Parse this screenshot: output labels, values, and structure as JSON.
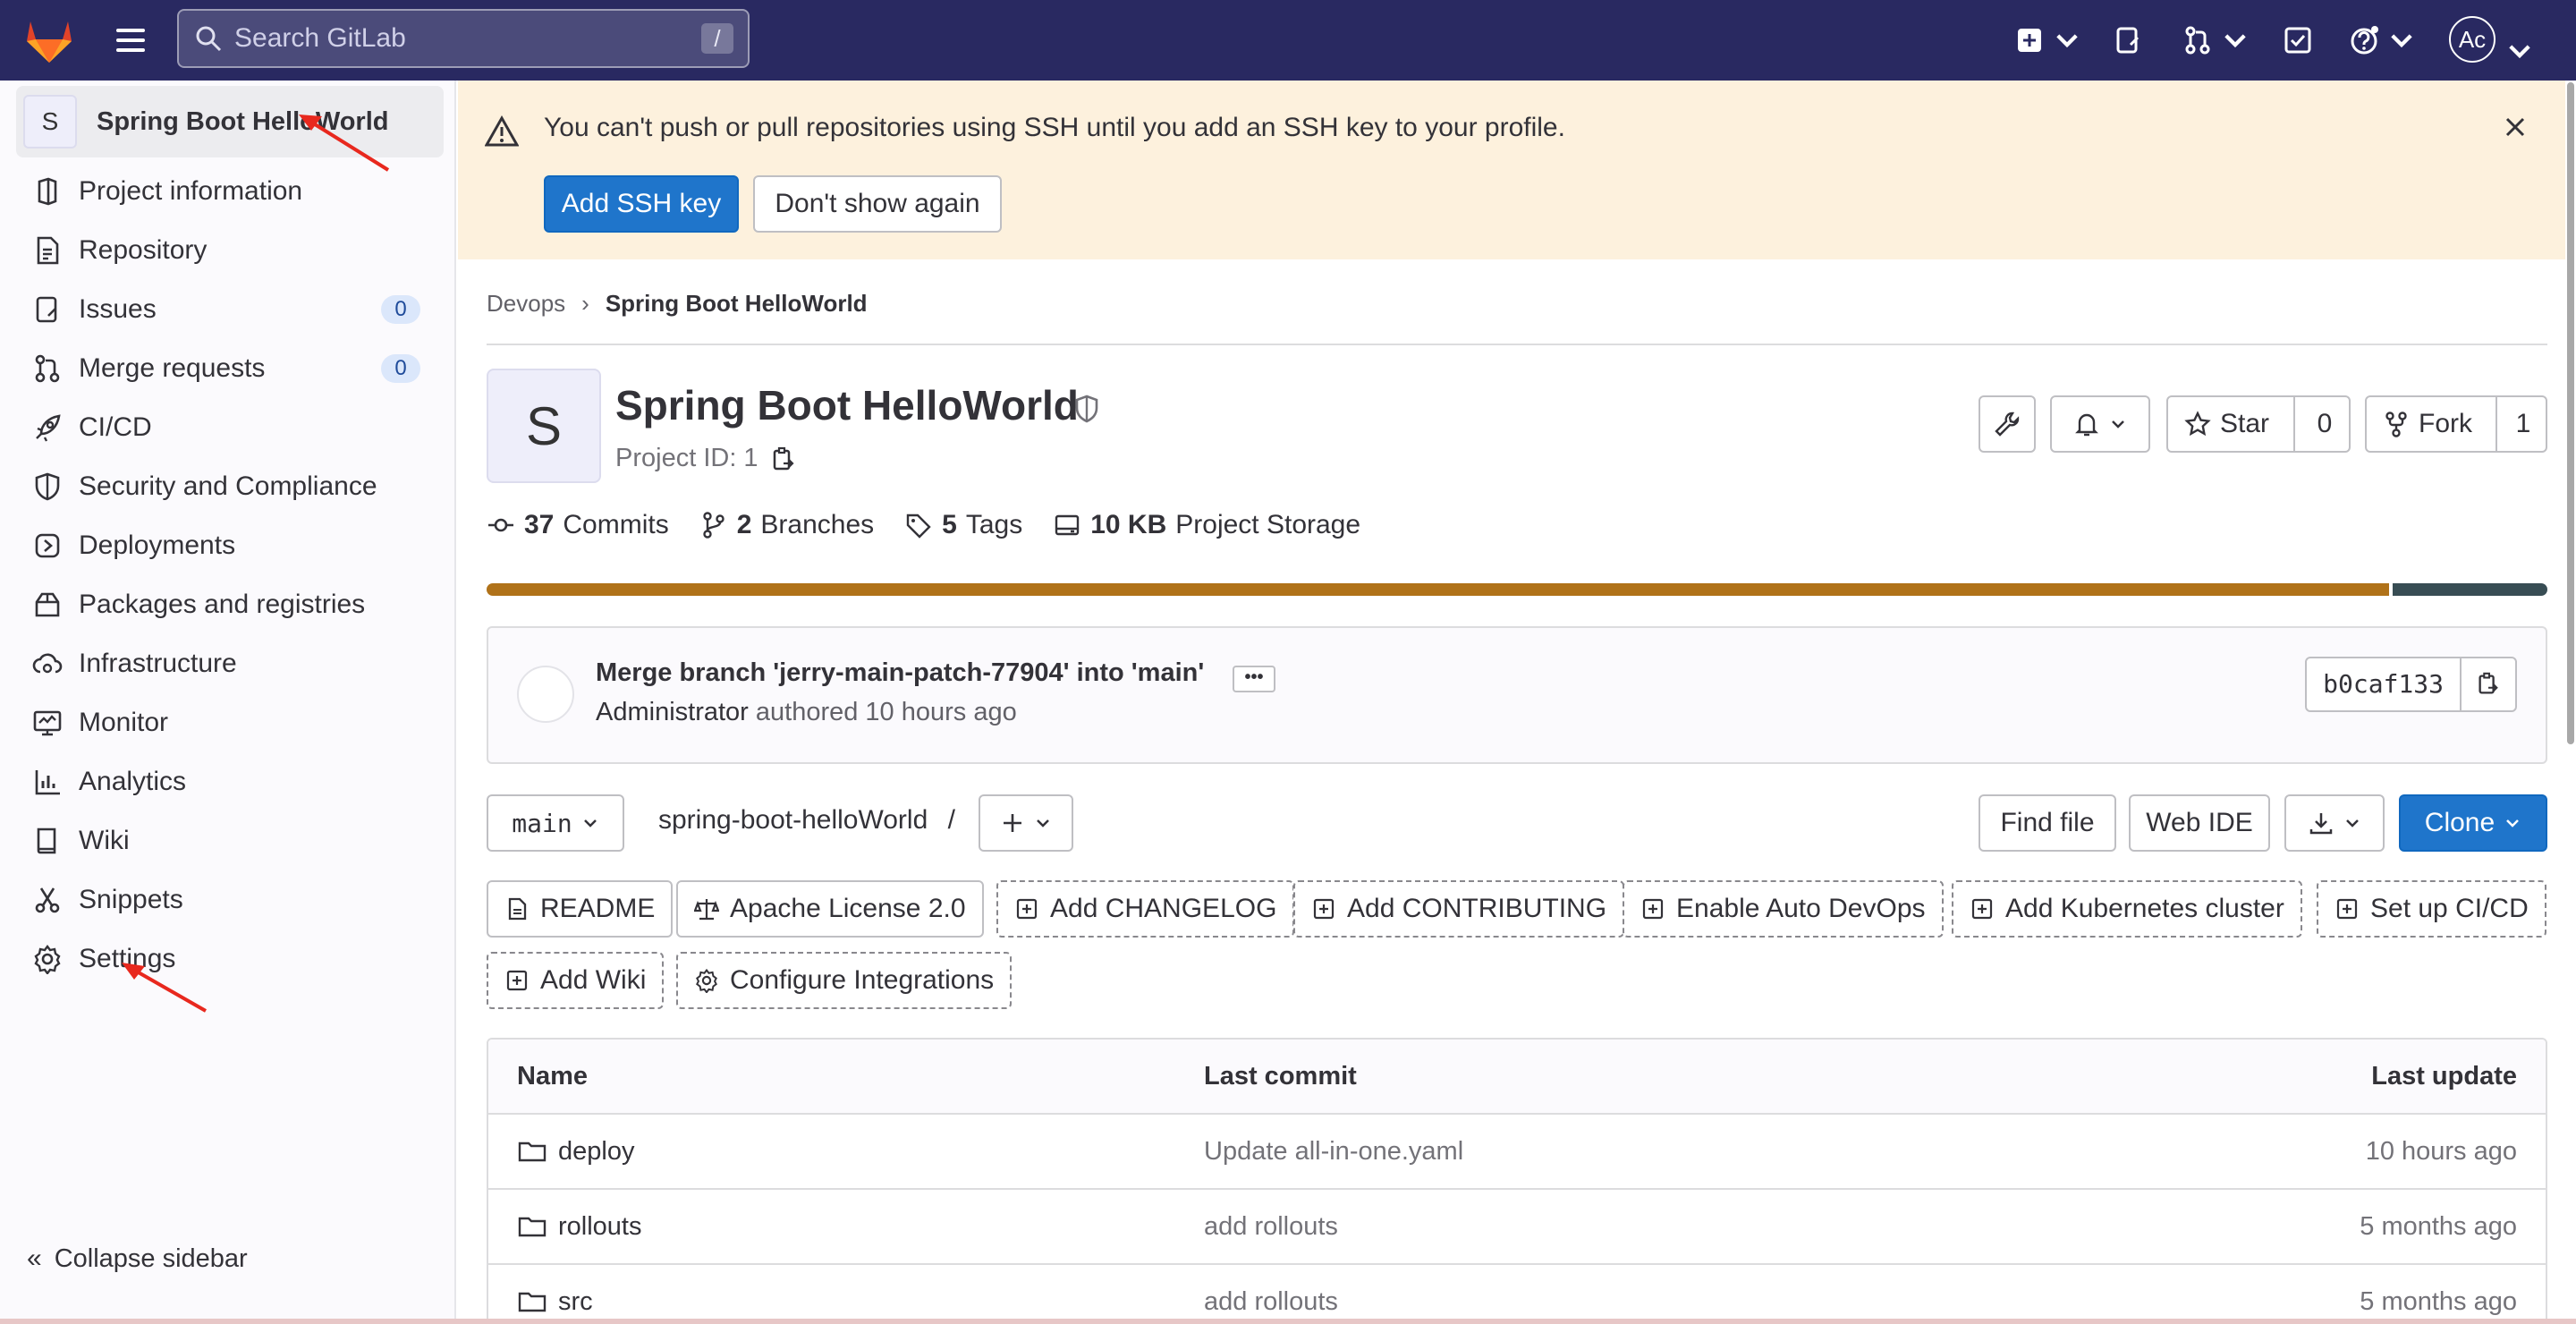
{
  "topbar": {
    "search_placeholder": "Search GitLab",
    "search_shortcut": "/",
    "avatar_initials": "Ac",
    "colors": {
      "background": "#292961",
      "logo_orange": "#e24329"
    }
  },
  "sidebar": {
    "project_initial": "S",
    "project_name": "Spring Boot HelloWorld",
    "items": [
      {
        "label": "Project information",
        "icon": "project-info-icon"
      },
      {
        "label": "Repository",
        "icon": "document-icon"
      },
      {
        "label": "Issues",
        "icon": "issues-icon",
        "count": "0"
      },
      {
        "label": "Merge requests",
        "icon": "merge-request-icon",
        "count": "0"
      },
      {
        "label": "CI/CD",
        "icon": "rocket-icon"
      },
      {
        "label": "Security and Compliance",
        "icon": "shield-icon"
      },
      {
        "label": "Deployments",
        "icon": "deployments-icon"
      },
      {
        "label": "Packages and registries",
        "icon": "package-icon"
      },
      {
        "label": "Infrastructure",
        "icon": "cloud-gear-icon"
      },
      {
        "label": "Monitor",
        "icon": "monitor-icon"
      },
      {
        "label": "Analytics",
        "icon": "chart-icon"
      },
      {
        "label": "Wiki",
        "icon": "book-icon"
      },
      {
        "label": "Snippets",
        "icon": "scissors-icon"
      },
      {
        "label": "Settings",
        "icon": "gear-icon"
      }
    ],
    "collapse_label": "Collapse sidebar"
  },
  "banner": {
    "message": "You can't push or pull repositories using SSH until you add an SSH key to your profile.",
    "add_key_label": "Add SSH key",
    "dismiss_label": "Don't show again",
    "color": "#fdf1dd"
  },
  "breadcrumb": {
    "group": "Devops",
    "project": "Spring Boot HelloWorld"
  },
  "project": {
    "initial": "S",
    "title": "Spring Boot HelloWorld",
    "id_text": "Project ID: 1",
    "star_label": "Star",
    "star_count": "0",
    "fork_label": "Fork",
    "fork_count": "1"
  },
  "stats": {
    "commits_num": "37",
    "commits_label": "Commits",
    "branches_num": "2",
    "branches_label": "Branches",
    "tags_num": "5",
    "tags_label": "Tags",
    "storage_num": "10 KB",
    "storage_label": "Project Storage"
  },
  "language_bar": [
    {
      "color": "#b07219",
      "share": 0.923
    },
    {
      "color": "#384d54",
      "share": 0.077
    }
  ],
  "last_commit": {
    "title": "Merge branch 'jerry-main-patch-77904' into 'main'",
    "author": "Administrator",
    "meta": "authored 10 hours ago",
    "sha": "b0caf133"
  },
  "repo_controls": {
    "branch": "main",
    "path": "spring-boot-helloWorld",
    "path_sep": "/",
    "find_file": "Find file",
    "web_ide": "Web IDE",
    "clone": "Clone"
  },
  "quick_actions": [
    {
      "label": "README",
      "style": "solid",
      "icon": "file-icon"
    },
    {
      "label": "Apache License 2.0",
      "style": "solid",
      "icon": "scale-icon"
    },
    {
      "label": "Add CHANGELOG",
      "style": "dashed",
      "icon": "plus-square-icon"
    },
    {
      "label": "Add CONTRIBUTING",
      "style": "dashed",
      "icon": "plus-square-icon"
    },
    {
      "label": "Enable Auto DevOps",
      "style": "dashed",
      "icon": "plus-square-icon"
    },
    {
      "label": "Add Kubernetes cluster",
      "style": "dashed",
      "icon": "plus-square-icon"
    },
    {
      "label": "Set up CI/CD",
      "style": "dashed",
      "icon": "plus-square-icon"
    },
    {
      "label": "Add Wiki",
      "style": "dashed",
      "icon": "plus-square-icon"
    },
    {
      "label": "Configure Integrations",
      "style": "dashed",
      "icon": "gear-icon"
    }
  ],
  "file_table": {
    "headers": {
      "name": "Name",
      "last_commit": "Last commit",
      "last_update": "Last update"
    },
    "rows": [
      {
        "name": "deploy",
        "commit": "Update all-in-one.yaml",
        "updated": "10 hours ago"
      },
      {
        "name": "rollouts",
        "commit": "add rollouts",
        "updated": "5 months ago"
      },
      {
        "name": "src",
        "commit": "add rollouts",
        "updated": "5 months ago"
      }
    ]
  }
}
